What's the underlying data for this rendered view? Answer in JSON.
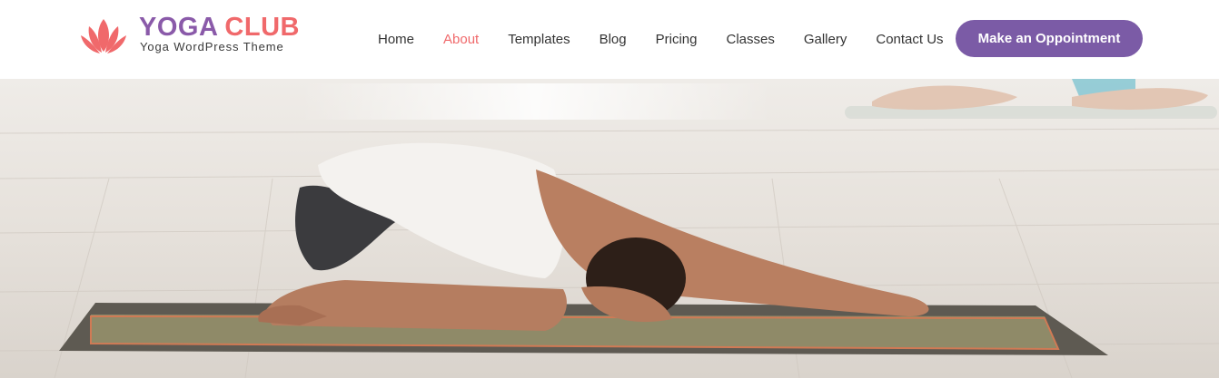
{
  "brand": {
    "title_word1": "YOGA",
    "title_word2": "CLUB",
    "tagline": "Yoga WordPress Theme",
    "logo_icon": "lotus-icon",
    "colors": {
      "purple": "#8a5aa9",
      "coral": "#f0696b"
    }
  },
  "nav": {
    "items": [
      {
        "label": "Home",
        "active": false
      },
      {
        "label": "About",
        "active": true
      },
      {
        "label": "Templates",
        "active": false
      },
      {
        "label": "Blog",
        "active": false
      },
      {
        "label": "Pricing",
        "active": false
      },
      {
        "label": "Classes",
        "active": false
      },
      {
        "label": "Gallery",
        "active": false
      },
      {
        "label": "Contact Us",
        "active": false
      }
    ],
    "active_color": "#f0696b"
  },
  "cta": {
    "label": "Make an Oppointment",
    "color": "#7b5ba6"
  },
  "hero": {
    "image": "woman-in-childs-pose-on-yoga-mat"
  }
}
